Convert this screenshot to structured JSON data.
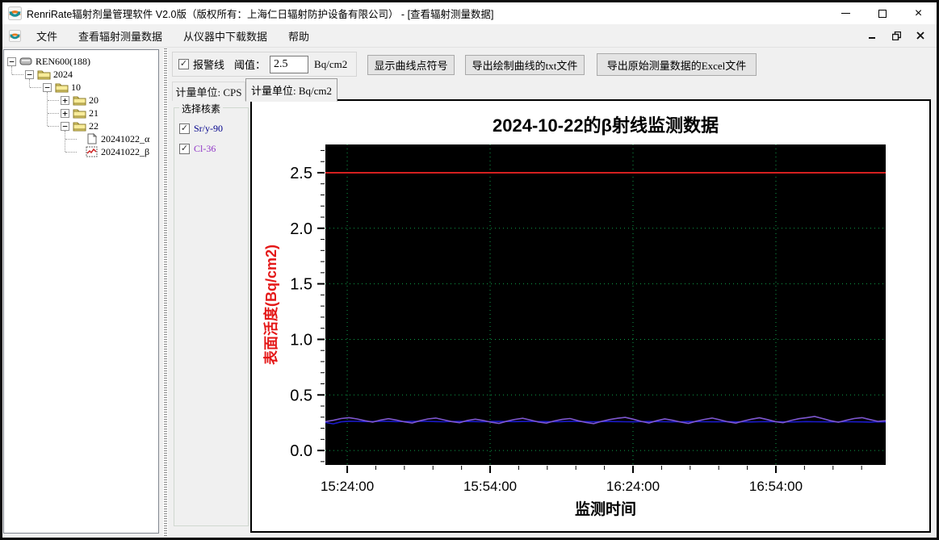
{
  "window": {
    "title": "RenriRate辐射剂量管理软件 V2.0版（版权所有：上海仁日辐射防护设备有限公司） - [查看辐射测量数据]",
    "icons": {
      "minimize": "minimize-icon",
      "maximize": "maximize-icon",
      "close": "close-icon"
    }
  },
  "menu": {
    "items": [
      {
        "label": "文件"
      },
      {
        "label": "查看辐射测量数据"
      },
      {
        "label": "从仪器中下载数据"
      },
      {
        "label": "帮助"
      }
    ]
  },
  "tree": {
    "items": [
      {
        "label": "REN600(188)",
        "depth": 0,
        "expander": "-",
        "icon": "device"
      },
      {
        "label": "2024",
        "depth": 1,
        "expander": "-",
        "icon": "folder"
      },
      {
        "label": "10",
        "depth": 2,
        "expander": "-",
        "icon": "folder"
      },
      {
        "label": "20",
        "depth": 3,
        "expander": "+",
        "icon": "folder"
      },
      {
        "label": "21",
        "depth": 3,
        "expander": "+",
        "icon": "folder"
      },
      {
        "label": "22",
        "depth": 3,
        "expander": "-",
        "icon": "folder"
      },
      {
        "label": "20241022_α",
        "depth": 4,
        "expander": "",
        "icon": "document"
      },
      {
        "label": "20241022_β",
        "depth": 4,
        "expander": "",
        "icon": "chart"
      }
    ]
  },
  "toolbar": {
    "alarm_checkbox_label": "报警线",
    "alarm_checked": true,
    "check_glyph": "✓",
    "threshold_label": "阈值：",
    "threshold_value": "2.5",
    "threshold_unit": "Bq/cm2",
    "show_points_button": "显示曲线点符号",
    "export_txt_button": "导出绘制曲线的txt文件",
    "export_excel_button": "导出原始测量数据的Excel文件"
  },
  "tabs": [
    {
      "label": "计量单位: CPS",
      "active": false
    },
    {
      "label": "计量单位: Bq/cm2",
      "active": true
    }
  ],
  "nuclides": {
    "group_label": "选择核素",
    "items": [
      {
        "label": "Sr/y-90",
        "checked": true,
        "color": "#00008b"
      },
      {
        "label": "Cl-36",
        "checked": true,
        "color": "#9137c8"
      }
    ]
  },
  "chart_data": {
    "type": "line",
    "title": "2024-10-22的β射线监测数据",
    "xlabel": "监测时间",
    "ylabel": "表面活度(Bq/cm2)",
    "ylabel_color": "#e41818",
    "plot_bg": "#000000",
    "grid_color": "#0fa04a",
    "grid_on": true,
    "legend_position": "none",
    "ylim": [
      -0.13,
      2.754
    ],
    "yticks": [
      0.0,
      0.5,
      1.0,
      1.5,
      2.0,
      2.5
    ],
    "ytick_labels": [
      "0.0",
      "0.5",
      "1.0",
      "1.5",
      "2.0",
      "2.5"
    ],
    "y_minor_step": 0.1,
    "x_tick_fracs": [
      0.039,
      0.294,
      0.549,
      0.804
    ],
    "x_tick_labels": [
      "15:24:00",
      "15:54:00",
      "16:24:00",
      "16:54:00"
    ],
    "x_minor_step_frac": 0.051,
    "alarm_value": 2.5,
    "alarm_color": "#d42020",
    "series": [
      {
        "name": "Sr/y-90",
        "color": "#1a1acc",
        "values": [
          0.253,
          0.24,
          0.258,
          0.263,
          0.262,
          0.26,
          0.261,
          0.263,
          0.262,
          0.26,
          0.261,
          0.262,
          0.263,
          0.262,
          0.26,
          0.259,
          0.261,
          0.262,
          0.261,
          0.26,
          0.259,
          0.261,
          0.262,
          0.261,
          0.26,
          0.261,
          0.262,
          0.261,
          0.26,
          0.259,
          0.26,
          0.262,
          0.261,
          0.26,
          0.259,
          0.26,
          0.261,
          0.26,
          0.259,
          0.258,
          0.26,
          0.261,
          0.26,
          0.259,
          0.258,
          0.259,
          0.261,
          0.26,
          0.259,
          0.258,
          0.259,
          0.26,
          0.259,
          0.258,
          0.257,
          0.259,
          0.26,
          0.259,
          0.258,
          0.257,
          0.258,
          0.26,
          0.259,
          0.258,
          0.257,
          0.258,
          0.259,
          0.258,
          0.257,
          0.256,
          0.258,
          0.257
        ]
      },
      {
        "name": "Cl-36",
        "color": "#7e57d0",
        "values": [
          0.26,
          0.272,
          0.288,
          0.296,
          0.284,
          0.268,
          0.256,
          0.274,
          0.286,
          0.274,
          0.258,
          0.248,
          0.268,
          0.284,
          0.292,
          0.276,
          0.26,
          0.25,
          0.27,
          0.282,
          0.27,
          0.254,
          0.244,
          0.264,
          0.28,
          0.29,
          0.274,
          0.256,
          0.246,
          0.266,
          0.28,
          0.288,
          0.268,
          0.252,
          0.242,
          0.262,
          0.278,
          0.29,
          0.298,
          0.282,
          0.262,
          0.248,
          0.268,
          0.284,
          0.272,
          0.256,
          0.244,
          0.264,
          0.28,
          0.292,
          0.276,
          0.258,
          0.246,
          0.266,
          0.282,
          0.294,
          0.278,
          0.26,
          0.25,
          0.27,
          0.286,
          0.296,
          0.306,
          0.288,
          0.268,
          0.254,
          0.272,
          0.288,
          0.296,
          0.278,
          0.262,
          0.268
        ]
      }
    ]
  }
}
